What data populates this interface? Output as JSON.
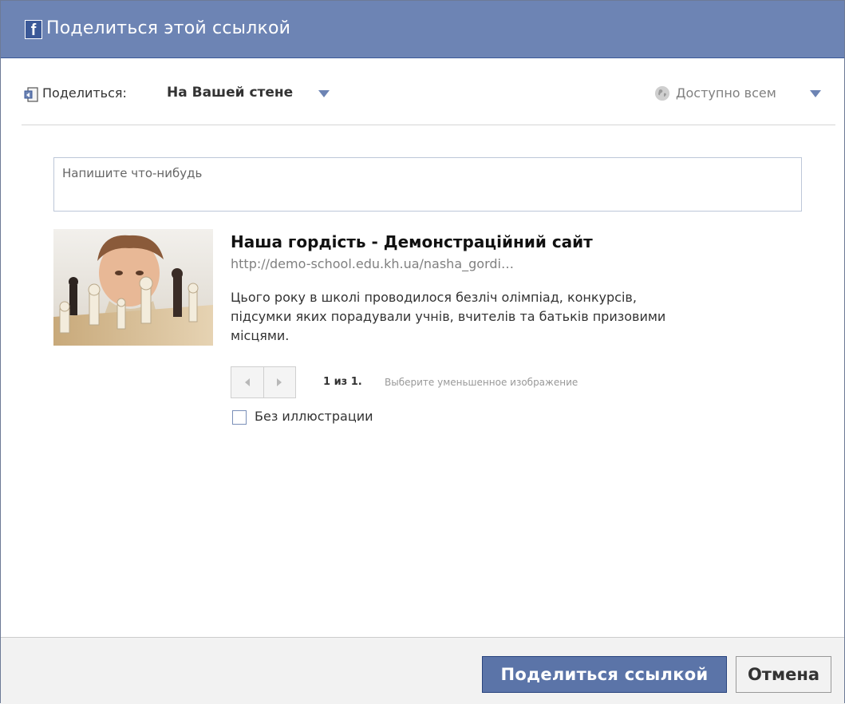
{
  "dialog": {
    "title": "Поделиться этой ссылкой",
    "logo_letter": "f"
  },
  "share": {
    "label": "Поделиться:",
    "target": "На Вашей стене",
    "privacy": "Доступно всем"
  },
  "message": {
    "placeholder": "Напишите что-нибудь",
    "value": ""
  },
  "link_preview": {
    "title": "Наша гордість - Демонстраційний сайт",
    "url": "http://demo-school.edu.kh.ua/nasha_gordi…",
    "description": "Цього року в школі проводилося безліч олімпіад, конкурсів, підсумки яких порадували учнів, вчителів та батьків призовими місцями.",
    "pager_count": "1 из 1.",
    "pager_hint": "Выберите уменьшенное изображение",
    "no_image_label": "Без иллюстрации"
  },
  "buttons": {
    "share": "Поделиться ссылкой",
    "cancel": "Отмена"
  },
  "colors": {
    "titlebar": "#6d84b4",
    "share_button": "#5b74a8"
  }
}
